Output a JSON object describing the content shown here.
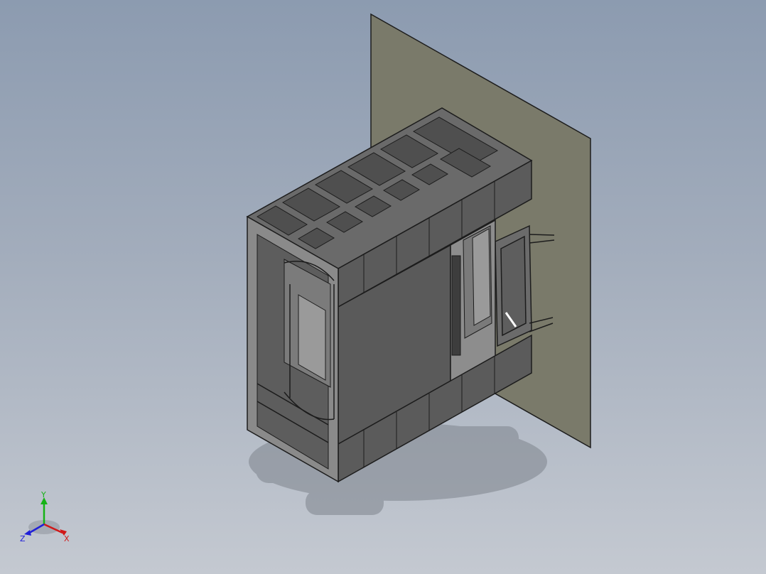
{
  "viewport": {
    "background_top": "#8c9bb0",
    "background_bottom": "#c4c9d1"
  },
  "model": {
    "frame_color": "#5b5b5b",
    "frame_edge_color": "#1c1c1c",
    "wall_color": "#7a7a6a"
  },
  "triad": {
    "x_label": "X",
    "y_label": "Y",
    "z_label": "Z",
    "x_color": "#d01818",
    "y_color": "#16b316",
    "z_color": "#2020d8"
  }
}
